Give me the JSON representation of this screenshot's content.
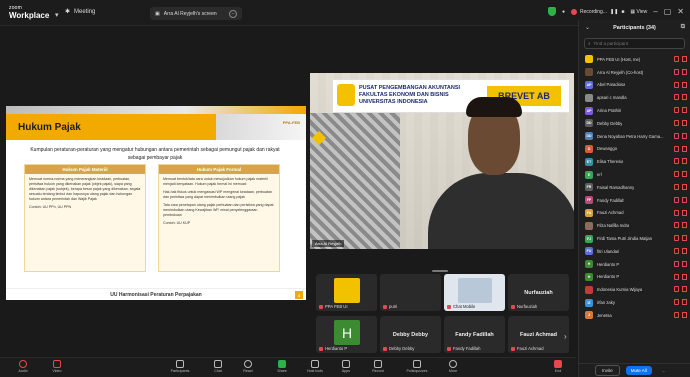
{
  "app": {
    "logo_top": "zoom",
    "logo_main": "Workplace"
  },
  "titlebar": {
    "meeting_label": "Meeting",
    "share_tab_label": "Arra Al Reyjelh's screen",
    "recording_label": "Recording...",
    "view_label": "View"
  },
  "slide": {
    "logo_text": "PPA-FEB",
    "title": "Hukum Pajak",
    "lead": "Kumpulan peraturan-peraturan yang mengatur hubungan antara pemerintah sebagai pemungut pajak dan rakyat sebagai pembayar pajak",
    "col1_header": "Hukum Pajak Materiil",
    "col1_p1": "Memuat norma-norma yang menerangkan keadaan, perbuatan, peristiwa hukum yang dikenakan pajak (objek pajak), siapa yang dikenakan pajak (subjek), berapa besar pajak yang dikenakan, segala sesuatu tentang timbul dan hapusnya utang pajak dan hubungan hukum antara pemerintah dan Wajib Pajak",
    "col1_p2": "Contoh: UU PPh, UU PPN",
    "col2_header": "Hukum Pajak Formal",
    "col2_p1": "Memuat bentuk/tata cara untuk mewujudkan hukum pajak materiil menjadi kenyataan. Hukum pajak formal ini memuat:",
    "col2_p2": "Hak-hak fiskus untuk mengawasi WP mengenai keadaan, perbuatan dan peristiwa yang dapat menimbulkan utang pajak",
    "col2_p3": "Tata cara penetapan utang pajak perbuatan dan peristiwa yang dapat menimbulkan utang Kewajiban WP, misal penyelenggaraan pembukuan",
    "col2_p4": "Contoh: UU KUP",
    "footer": "UU Harmonisasi Peraturan Perpajakan",
    "page": "4"
  },
  "video": {
    "banner_line1": "PUSAT PENGEMBANGAN AKUNTANSI",
    "banner_line2": "FAKULTAS EKONOMI DAN BISNIS",
    "banner_line3": "UNIVERSITAS INDONESIA",
    "banner_right": "BREVET AB",
    "name": "Arra Al Reyjelh"
  },
  "gallery": {
    "tiles": [
      {
        "label": "PPA FEB UI",
        "center": ""
      },
      {
        "label": "putri",
        "center": ""
      },
      {
        "label": "Chat Mobile",
        "center": ""
      },
      {
        "label": "Nurfauziah",
        "center": "Nurfauziah"
      },
      {
        "label": "Herdianto P",
        "center": ""
      },
      {
        "label": "Debby Debby",
        "center": "Debby Debby"
      },
      {
        "label": "Fandy Fadillah",
        "center": "Fandy Fadillah"
      },
      {
        "label": "Fauzi Achmad",
        "center": "Fauzi Achmad"
      }
    ],
    "avatar_letter": "H"
  },
  "toolbar": {
    "items": [
      "Audio",
      "Video",
      "Participants",
      "Chat",
      "React",
      "Share",
      "Host tools",
      "Apps",
      "Record",
      "Polls/quizzes",
      "More",
      "End"
    ]
  },
  "participants": {
    "title": "Participants (34)",
    "search_placeholder": "Find a participant",
    "list": [
      {
        "name": "PPA FEB UI (Host, me)",
        "initials": "",
        "color": "#f2c200"
      },
      {
        "name": "Arra Al Reyjelh (Co-host)",
        "initials": "",
        "color": "#6b4a33"
      },
      {
        "name": "Abel Paradiosa",
        "initials": "AP",
        "color": "#5b6fd6"
      },
      {
        "name": "apsari c mandla",
        "initials": "",
        "color": "#8a8a8a"
      },
      {
        "name": "Arina Prathiri",
        "initials": "AP",
        "color": "#7b5cd6"
      },
      {
        "name": "Debby Debby",
        "initials": "DD",
        "color": "#5d5d5d"
      },
      {
        "name": "Dena Noyahan Petra Harry Gama...",
        "initials": "DD",
        "color": "#4a7fb8"
      },
      {
        "name": "Dewanggo",
        "initials": "D",
        "color": "#d65c3a"
      },
      {
        "name": "Elisa Theresia",
        "initials": "ET",
        "color": "#2f8fa3"
      },
      {
        "name": "erl",
        "initials": "E",
        "color": "#3aa35c"
      },
      {
        "name": "Faisal Ramadhanny",
        "initials": "FR",
        "color": "#5d5d5d"
      },
      {
        "name": "Fandy Fadillah",
        "initials": "FF",
        "color": "#b84a7a"
      },
      {
        "name": "Fauzi Achmad",
        "initials": "FA",
        "color": "#d6a33a"
      },
      {
        "name": "Filza Nafilla Indra",
        "initials": "",
        "color": "#8a6d5a"
      },
      {
        "name": "Firdi Tama Putri Jindia Matjan",
        "initials": "FJ",
        "color": "#3aa35c"
      },
      {
        "name": "fitri Ulandari",
        "initials": "FU",
        "color": "#5b6fd6"
      },
      {
        "name": "Herdianto P",
        "initials": "H",
        "color": "#3c8b32"
      },
      {
        "name": "Herdianto P",
        "initials": "H",
        "color": "#3c8b32"
      },
      {
        "name": "Indonesia Kurnia Wijaya",
        "initials": "",
        "color": "#c23a3a"
      },
      {
        "name": "irfan zaky",
        "initials": "IZ",
        "color": "#3a8fd6"
      },
      {
        "name": "Jenetsa",
        "initials": "J",
        "color": "#d67a3a"
      }
    ],
    "invite_label": "Invite",
    "mute_label": "Mute All",
    "more_label": "..."
  },
  "colors": {
    "accent": "#0e72ed",
    "brand_yellow": "#f2a900",
    "muted_red": "#e5484d",
    "shield_green": "#2bb34a"
  }
}
